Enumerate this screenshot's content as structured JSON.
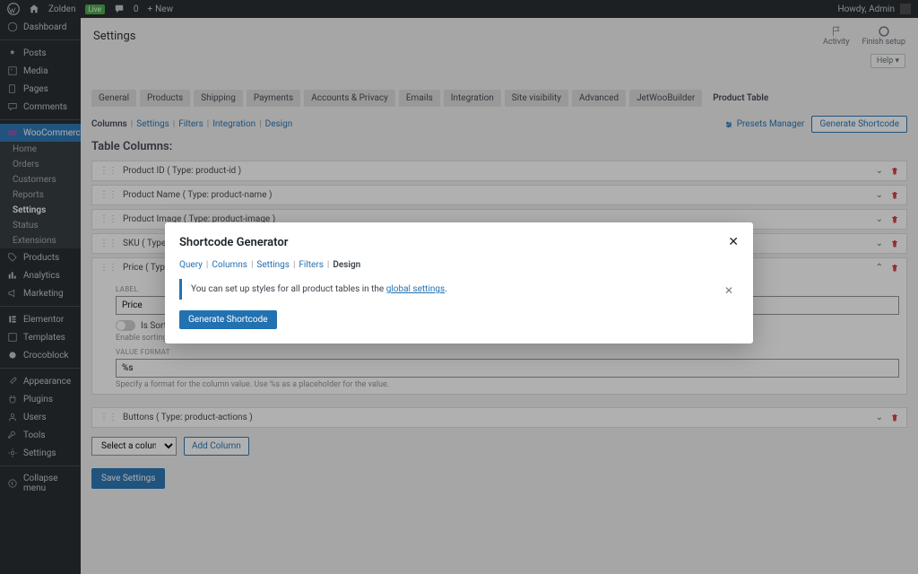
{
  "admin_bar": {
    "site_name": "Zolden",
    "live_badge": "Live",
    "comments_count": "0",
    "new_label": "New",
    "howdy": "Howdy, Admin"
  },
  "sidebar": {
    "items": [
      {
        "label": "Dashboard",
        "icon": "dashboard-icon"
      },
      {
        "label": "Posts",
        "icon": "pin-icon"
      },
      {
        "label": "Media",
        "icon": "media-icon"
      },
      {
        "label": "Pages",
        "icon": "page-icon"
      },
      {
        "label": "Comments",
        "icon": "comment-icon"
      },
      {
        "label": "WooCommerce",
        "icon": "woo-icon",
        "active": true
      },
      {
        "label": "Products",
        "icon": "tag-icon"
      },
      {
        "label": "Analytics",
        "icon": "chart-icon"
      },
      {
        "label": "Marketing",
        "icon": "megaphone-icon"
      },
      {
        "label": "Elementor",
        "icon": "elementor-icon"
      },
      {
        "label": "Templates",
        "icon": "templates-icon"
      },
      {
        "label": "Crocoblock",
        "icon": "croco-icon"
      },
      {
        "label": "Appearance",
        "icon": "brush-icon"
      },
      {
        "label": "Plugins",
        "icon": "plug-icon"
      },
      {
        "label": "Users",
        "icon": "user-icon"
      },
      {
        "label": "Tools",
        "icon": "wrench-icon"
      },
      {
        "label": "Settings",
        "icon": "gear-icon"
      },
      {
        "label": "Collapse menu",
        "icon": "collapse-icon"
      }
    ],
    "woo_sub": [
      "Home",
      "Orders",
      "Customers",
      "Reports",
      "Settings",
      "Status",
      "Extensions"
    ]
  },
  "page": {
    "title": "Settings",
    "activity": "Activity",
    "finish": "Finish setup",
    "help": "Help ▾"
  },
  "tabs": [
    "General",
    "Products",
    "Shipping",
    "Payments",
    "Accounts & Privacy",
    "Emails",
    "Integration",
    "Site visibility",
    "Advanced",
    "JetWooBuilder",
    "Product Table"
  ],
  "subnav": [
    "Columns",
    "Settings",
    "Filters",
    "Integration",
    "Design"
  ],
  "subnav_actions": {
    "presets": "Presets Manager",
    "generate": "Generate Shortcode"
  },
  "section_title": "Table Columns:",
  "columns": [
    {
      "title": "Product ID ( Type: product-id )"
    },
    {
      "title": "Product Name ( Type: product-name )"
    },
    {
      "title": "Product Image ( Type: product-image )"
    },
    {
      "title": "SKU ( Type: product"
    },
    {
      "title": "Price ( Type: produc",
      "expanded": true
    },
    {
      "title": "Buttons ( Type: product-actions )"
    }
  ],
  "price_fields": {
    "label_caption": "LABEL",
    "label_value": "Price",
    "sortable_label": "Is Sortable",
    "sortable_help": "Enable sorting for this co",
    "format_caption": "VALUE FORMAT",
    "format_value": "%s",
    "format_help": "Specify a format for the column value. Use %s as a placeholder for the value."
  },
  "add_row": {
    "placeholder": "Select a column...",
    "button": "Add Column"
  },
  "save_button": "Save Settings",
  "modal": {
    "title": "Shortcode Generator",
    "subnav": [
      "Query",
      "Columns",
      "Settings",
      "Filters",
      "Design"
    ],
    "notice_prefix": "You can set up styles for all product tables in the ",
    "notice_link": "global settings",
    "notice_suffix": ".",
    "button": "Generate Shortcode"
  }
}
